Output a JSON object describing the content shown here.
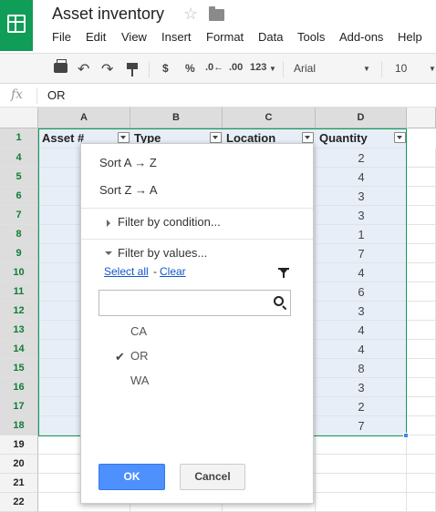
{
  "app": {
    "title": "Asset inventory",
    "brand_color": "#0f9d58"
  },
  "menu": [
    "File",
    "Edit",
    "View",
    "Insert",
    "Format",
    "Data",
    "Tools",
    "Add-ons",
    "Help"
  ],
  "toolbar": {
    "currency": "$",
    "percent": "%",
    "decrease_decimals": ".0←",
    "increase_decimals": ".00",
    "more_formats": "123",
    "font": "Arial",
    "font_size": "10"
  },
  "formula_bar": {
    "fx": "fx",
    "value": "OR"
  },
  "sheet": {
    "columns": [
      "A",
      "B",
      "C",
      "D"
    ],
    "rows": [
      "1",
      "4",
      "5",
      "6",
      "7",
      "8",
      "9",
      "10",
      "11",
      "12",
      "13",
      "14",
      "15",
      "16",
      "17",
      "18",
      "19",
      "20",
      "21",
      "22"
    ],
    "headers": [
      "Asset #",
      "Type",
      "Location",
      "Quantity"
    ],
    "quantities": [
      "2",
      "4",
      "3",
      "3",
      "1",
      "7",
      "4",
      "6",
      "3",
      "4",
      "4",
      "8",
      "3",
      "2",
      "7"
    ],
    "selection_color": "#e8eef8"
  },
  "filter_menu": {
    "sort_asc": "Sort A → Z",
    "sort_desc": "Sort Z → A",
    "by_condition": "Filter by condition...",
    "by_values": "Filter by values...",
    "select_all": "Select all",
    "separator": "-",
    "clear": "Clear",
    "search_placeholder": "",
    "values": [
      {
        "label": "CA",
        "checked": false
      },
      {
        "label": "OR",
        "checked": true
      },
      {
        "label": "WA",
        "checked": false
      }
    ],
    "ok": "OK",
    "cancel": "Cancel"
  }
}
